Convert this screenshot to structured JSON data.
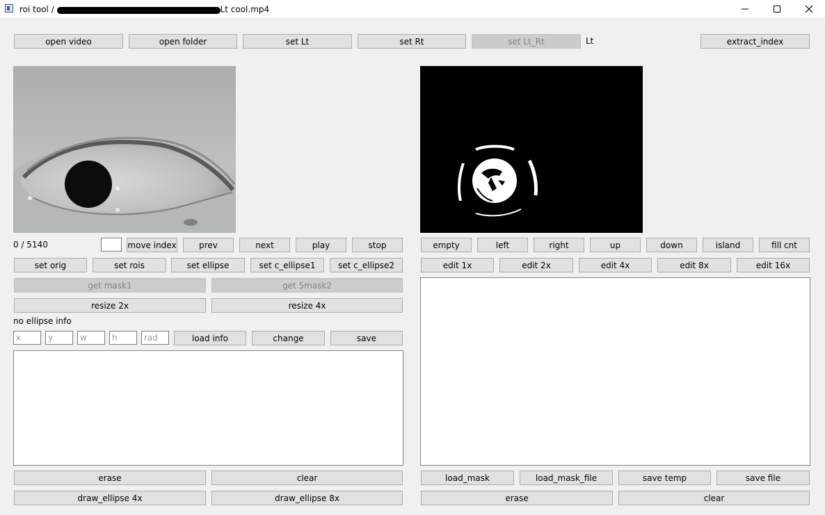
{
  "window": {
    "title_prefix": "roi tool / ",
    "title_suffix": "Lt cool.mp4",
    "minimize_icon": "minimize-icon",
    "maximize_icon": "maximize-icon",
    "close_icon": "close-icon"
  },
  "toolbar": {
    "open_video": "open video",
    "open_folder": "open folder",
    "set_lt": "set Lt",
    "set_rt": "set Rt",
    "set_lt_rt": "set Lt_Rt",
    "side_label": "Lt",
    "extract_index": "extract_index"
  },
  "left": {
    "frame_counter": "0 / 5140",
    "index_value": "",
    "move_index": "move index",
    "prev": "prev",
    "next": "next",
    "play": "play",
    "stop": "stop",
    "set_orig": "set orig",
    "set_rois": "set rois",
    "set_ellipse": "set ellipse",
    "set_c_ellipse1": "set c_ellipse1",
    "set_c_ellipse2": "set c_ellipse2",
    "get_mask1": "get mask1",
    "get_5mask2": "get 5mask2",
    "resize_2x": "resize 2x",
    "resize_4x": "resize 4x",
    "ellipse_info": "no ellipse info",
    "ellipse_fields": {
      "x_placeholder": "x",
      "y_placeholder": "y",
      "w_placeholder": "w",
      "h_placeholder": "h",
      "rad_placeholder": "rad"
    },
    "load_info": "load info",
    "change": "change",
    "save": "save",
    "erase": "erase",
    "clear": "clear",
    "draw_ellipse_4x": "draw_ellipse 4x",
    "draw_ellipse_8x": "draw_ellipse 8x"
  },
  "right": {
    "empty": "empty",
    "left": "left",
    "right": "right",
    "up": "up",
    "down": "down",
    "island": "island",
    "fill_cnt": "fill cnt",
    "edit_1x": "edit 1x",
    "edit_2x": "edit 2x",
    "edit_4x": "edit 4x",
    "edit_8x": "edit 8x",
    "edit_16x": "edit 16x",
    "load_mask": "load_mask",
    "load_mask_file": "load_mask_file",
    "save_temp": "save temp",
    "save_file": "save file",
    "erase": "erase",
    "clear": "clear"
  },
  "colors": {
    "button_bg": "#e1e1e1",
    "button_border": "#adadad",
    "disabled_bg": "#cccccc",
    "disabled_text": "#838383",
    "window_bg": "#f0f0f0"
  }
}
